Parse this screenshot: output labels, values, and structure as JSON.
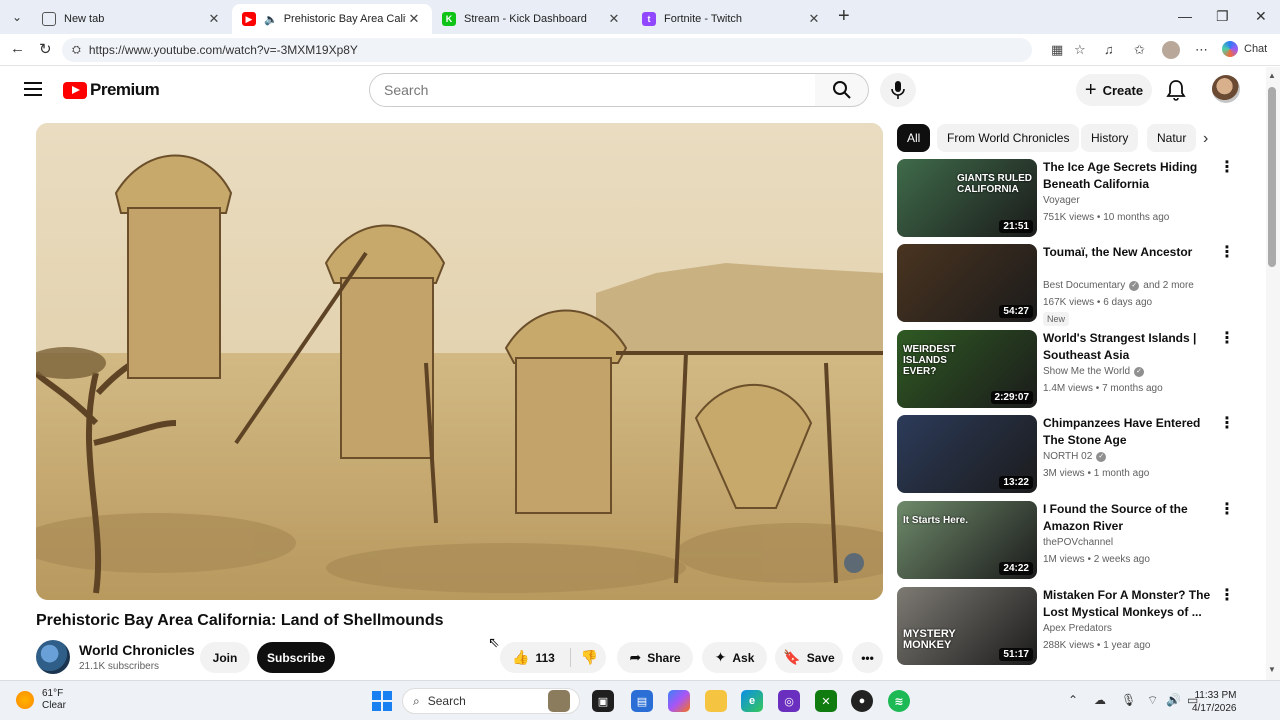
{
  "browser": {
    "tabs": [
      {
        "title": "New tab",
        "icon": "newtab-icon",
        "active": false
      },
      {
        "title": "Prehistoric Bay Area California: Land of Shellmounds",
        "icon": "youtube-icon",
        "active": true
      },
      {
        "title": "Stream - Kick Dashboard",
        "icon": "kick-icon",
        "active": false
      },
      {
        "title": "Fortnite - Twitch",
        "icon": "twitch-icon",
        "active": false
      }
    ],
    "url": "https://www.youtube.com/watch?v=-3MXM19Xp8Y",
    "chat_label": "Chat"
  },
  "header": {
    "brand": "Premium",
    "search_placeholder": "Search",
    "create_label": "Create"
  },
  "video": {
    "title": "Prehistoric Bay Area California: Land of Shellmounds",
    "channel": "World Chronicles",
    "subscribers": "21.1K subscribers",
    "join_label": "Join",
    "subscribe_label": "Subscribe",
    "likes": "113",
    "share_label": "Share",
    "ask_label": "Ask",
    "save_label": "Save"
  },
  "chips": [
    "All",
    "From World Chronicles",
    "History",
    "Natur"
  ],
  "recommendations": [
    {
      "title": "The Ice Age Secrets Hiding Beneath California",
      "channel": "Voyager",
      "verified": false,
      "extra": "",
      "meta": "751K views • 10 months ago",
      "duration": "21:51",
      "overlay": "GIANTS RULED CALIFORNIA",
      "badge": "",
      "thumb": "#3f6b4a"
    },
    {
      "title": "Toumaï, the New Ancestor",
      "channel": "Best Documentary",
      "verified": true,
      "extra": "and 2 more",
      "meta": "167K views • 6 days ago",
      "duration": "54:27",
      "overlay": "",
      "badge": "New",
      "thumb": "#4a3420"
    },
    {
      "title": "World's Strangest Islands | Southeast Asia",
      "channel": "Show Me the World",
      "verified": true,
      "extra": "",
      "meta": "1.4M views • 7 months ago",
      "duration": "2:29:07",
      "overlay": "WEIRDEST ISLANDS EVER?",
      "badge": "",
      "thumb": "#2f5a23"
    },
    {
      "title": "Chimpanzees Have Entered The Stone Age",
      "channel": "NORTH 02",
      "verified": true,
      "extra": "",
      "meta": "3M views • 1 month ago",
      "duration": "13:22",
      "overlay": "",
      "badge": "",
      "thumb": "#2c3b5a"
    },
    {
      "title": "I Found the Source of the Amazon River",
      "channel": "thePOVchannel",
      "verified": false,
      "extra": "",
      "meta": "1M views • 2 weeks ago",
      "duration": "24:22",
      "overlay": "It Starts Here.",
      "badge": "",
      "thumb": "#6e8a6a"
    },
    {
      "title": "Mistaken For A Monster? The Lost Mystical Monkeys of ...",
      "channel": "Apex Predators",
      "verified": false,
      "extra": "",
      "meta": "288K views • 1 year ago",
      "duration": "51:17",
      "overlay": "MYSTERY MONKEY",
      "badge": "",
      "thumb": "#7d7a73"
    }
  ],
  "taskbar": {
    "temperature": "61°F",
    "condition": "Clear",
    "search_label": "Search",
    "time": "11:33 PM",
    "date": "4/17/2026"
  }
}
